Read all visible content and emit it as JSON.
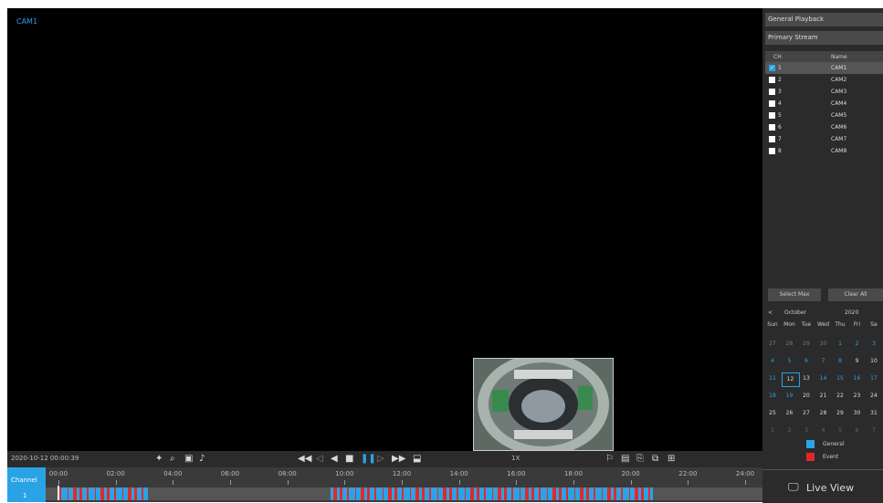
{
  "video": {
    "camera_label": "CAM1"
  },
  "toolbar": {
    "timestamp": "2020-10-12 00:00:39",
    "speed": "1X",
    "left_icons": [
      "fisheye-icon",
      "zoom-icon",
      "snapshot-icon",
      "mute-icon"
    ],
    "center_icons": [
      "fast-rewind-icon",
      "step-back-icon",
      "reverse-play-icon",
      "stop-icon",
      "pause-icon",
      "step-forward-icon",
      "fast-forward-icon",
      "clip-icon"
    ],
    "right_icons": [
      "tag-icon",
      "save-icon",
      "export-icon",
      "tile-icon",
      "layout-icon"
    ]
  },
  "timeline": {
    "channel_label": "Channel",
    "channel_number": "1",
    "ticks": [
      "00:00",
      "02:00",
      "04:00",
      "06:00",
      "08:00",
      "10:00",
      "12:00",
      "14:00",
      "16:00",
      "18:00",
      "20:00",
      "22:00",
      "24:00"
    ]
  },
  "panel": {
    "playback_mode": "General Playback",
    "stream": "Primary Stream",
    "ch_header": "CH",
    "name_header": "Name",
    "channels": [
      {
        "num": "1",
        "name": "CAM1",
        "checked": true
      },
      {
        "num": "2",
        "name": "CAM2",
        "checked": false
      },
      {
        "num": "3",
        "name": "CAM3",
        "checked": false
      },
      {
        "num": "4",
        "name": "CAM4",
        "checked": false
      },
      {
        "num": "5",
        "name": "CAM5",
        "checked": false
      },
      {
        "num": "6",
        "name": "CAM6",
        "checked": false
      },
      {
        "num": "7",
        "name": "CAM7",
        "checked": false
      },
      {
        "num": "8",
        "name": "CAM8",
        "checked": false
      }
    ],
    "select_max": "Select Max",
    "clear_all": "Clear All",
    "calendar": {
      "prev": "<",
      "month": "October",
      "year": "2020",
      "weekdays": [
        "Sun",
        "Mon",
        "Tue",
        "Wed",
        "Thu",
        "Fri",
        "Sa"
      ],
      "rows": [
        [
          "27",
          "28",
          "29",
          "30",
          "1",
          "2",
          "3"
        ],
        [
          "4",
          "5",
          "6",
          "7",
          "8",
          "9",
          "10"
        ],
        [
          "11",
          "12",
          "13",
          "14",
          "15",
          "16",
          "17"
        ],
        [
          "18",
          "19",
          "20",
          "21",
          "22",
          "23",
          "24"
        ],
        [
          "25",
          "26",
          "27",
          "28",
          "29",
          "30",
          "31"
        ],
        [
          "1",
          "2",
          "3",
          "4",
          "5",
          "6",
          "7"
        ]
      ]
    },
    "legend_general": "General",
    "legend_event": "Event",
    "live_view": "Live View",
    "colors": {
      "general": "#2aa3e6",
      "event": "#e02a2a"
    }
  }
}
